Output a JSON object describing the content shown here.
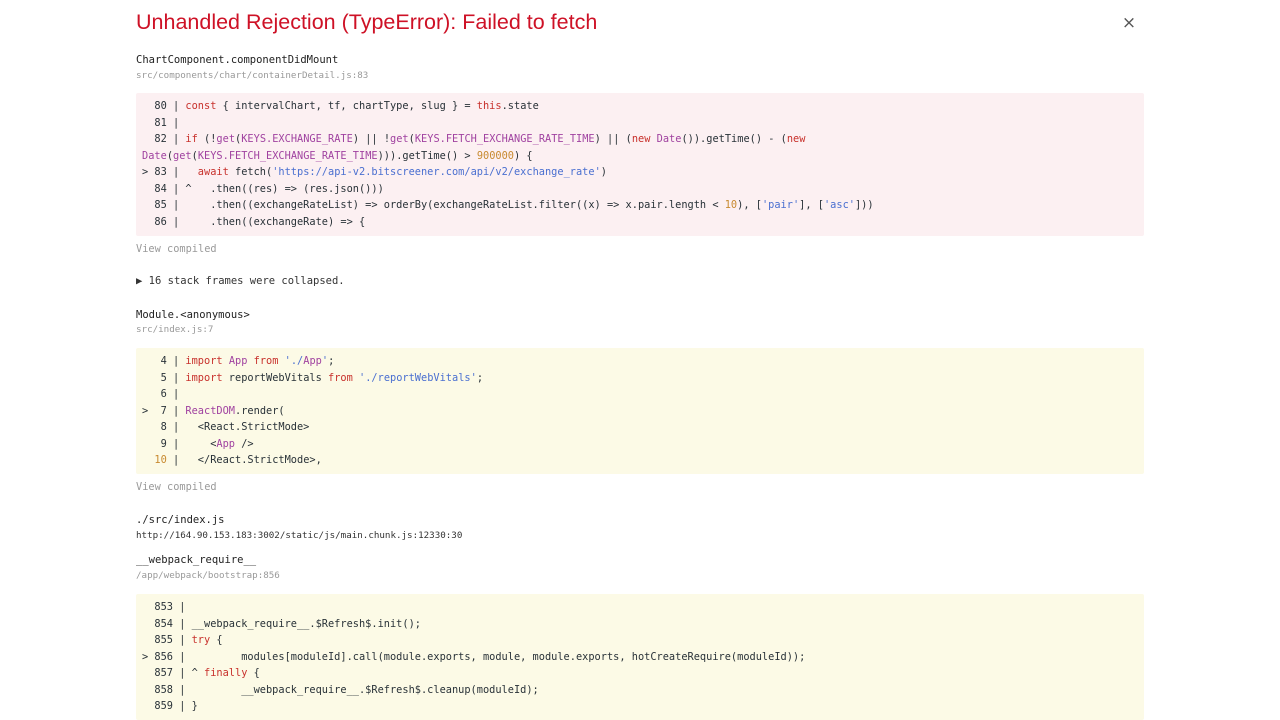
{
  "error": {
    "title": "Unhandled Rejection (TypeError): Failed to fetch",
    "close_glyph": "×"
  },
  "frames": [
    {
      "function": "ChartComponent.componentDidMount",
      "location": "src/components/chart/containerDetail.js:83",
      "view_compiled": "View compiled",
      "lines": [
        "  80 | const { intervalChart, tf, chartType, slug } = this.state",
        "  81 |",
        "  82 | if (!get(KEYS.EXCHANGE_RATE) || !get(KEYS.FETCH_EXCHANGE_RATE_TIME) || (new Date()).getTime() - (new",
        "Date(get(KEYS.FETCH_EXCHANGE_RATE_TIME))).getTime() > 900000) {",
        "> 83 |   await fetch('https://api-v2.bitscreener.com/api/v2/exchange_rate')",
        "  84 | ^   .then((res) => (res.json()))",
        "  85 |     .then((exchangeRateList) => orderBy(exchangeRateList.filter((x) => x.pair.length < 10), ['pair'], ['asc']))",
        "  86 |     .then((exchangeRate) => {"
      ]
    },
    {
      "function": "Module.<anonymous>",
      "location": "src/index.js:7",
      "view_compiled": "View compiled",
      "lines": [
        "   4 | import App from './App';",
        "   5 | import reportWebVitals from './reportWebVitals';",
        "   6 |",
        ">  7 | ReactDOM.render(",
        "   8 |   <React.StrictMode>",
        "   9 |     <App />",
        "  10 |   </React.StrictMode>,"
      ]
    },
    {
      "function": "./src/index.js",
      "location": "http://164.90.153.183:3002/static/js/main.chunk.js:12330:30"
    },
    {
      "function": "__webpack_require__",
      "location": "/app/webpack/bootstrap:856",
      "lines": [
        "  853 |",
        "  854 | __webpack_require__.$Refresh$.init();",
        "  855 | try {",
        "> 856 |         modules[moduleId].call(module.exports, module, module.exports, hotCreateRequire(moduleId));",
        "  857 | ^ finally {",
        "  858 |         __webpack_require__.$Refresh$.cleanup(moduleId);",
        "  859 | }"
      ]
    }
  ],
  "collapsed": {
    "arrow": "▶",
    "label": "16 stack frames were collapsed."
  },
  "colors": {
    "title": "#ce1126",
    "error_code_bg": "#fcf0f2",
    "code_bg": "#fcfae6",
    "keyword": "#c8312c",
    "identifier": "#a042a0",
    "string": "#4a6fd0"
  },
  "icons": [
    "close-icon",
    "collapse-arrow-icon"
  ]
}
